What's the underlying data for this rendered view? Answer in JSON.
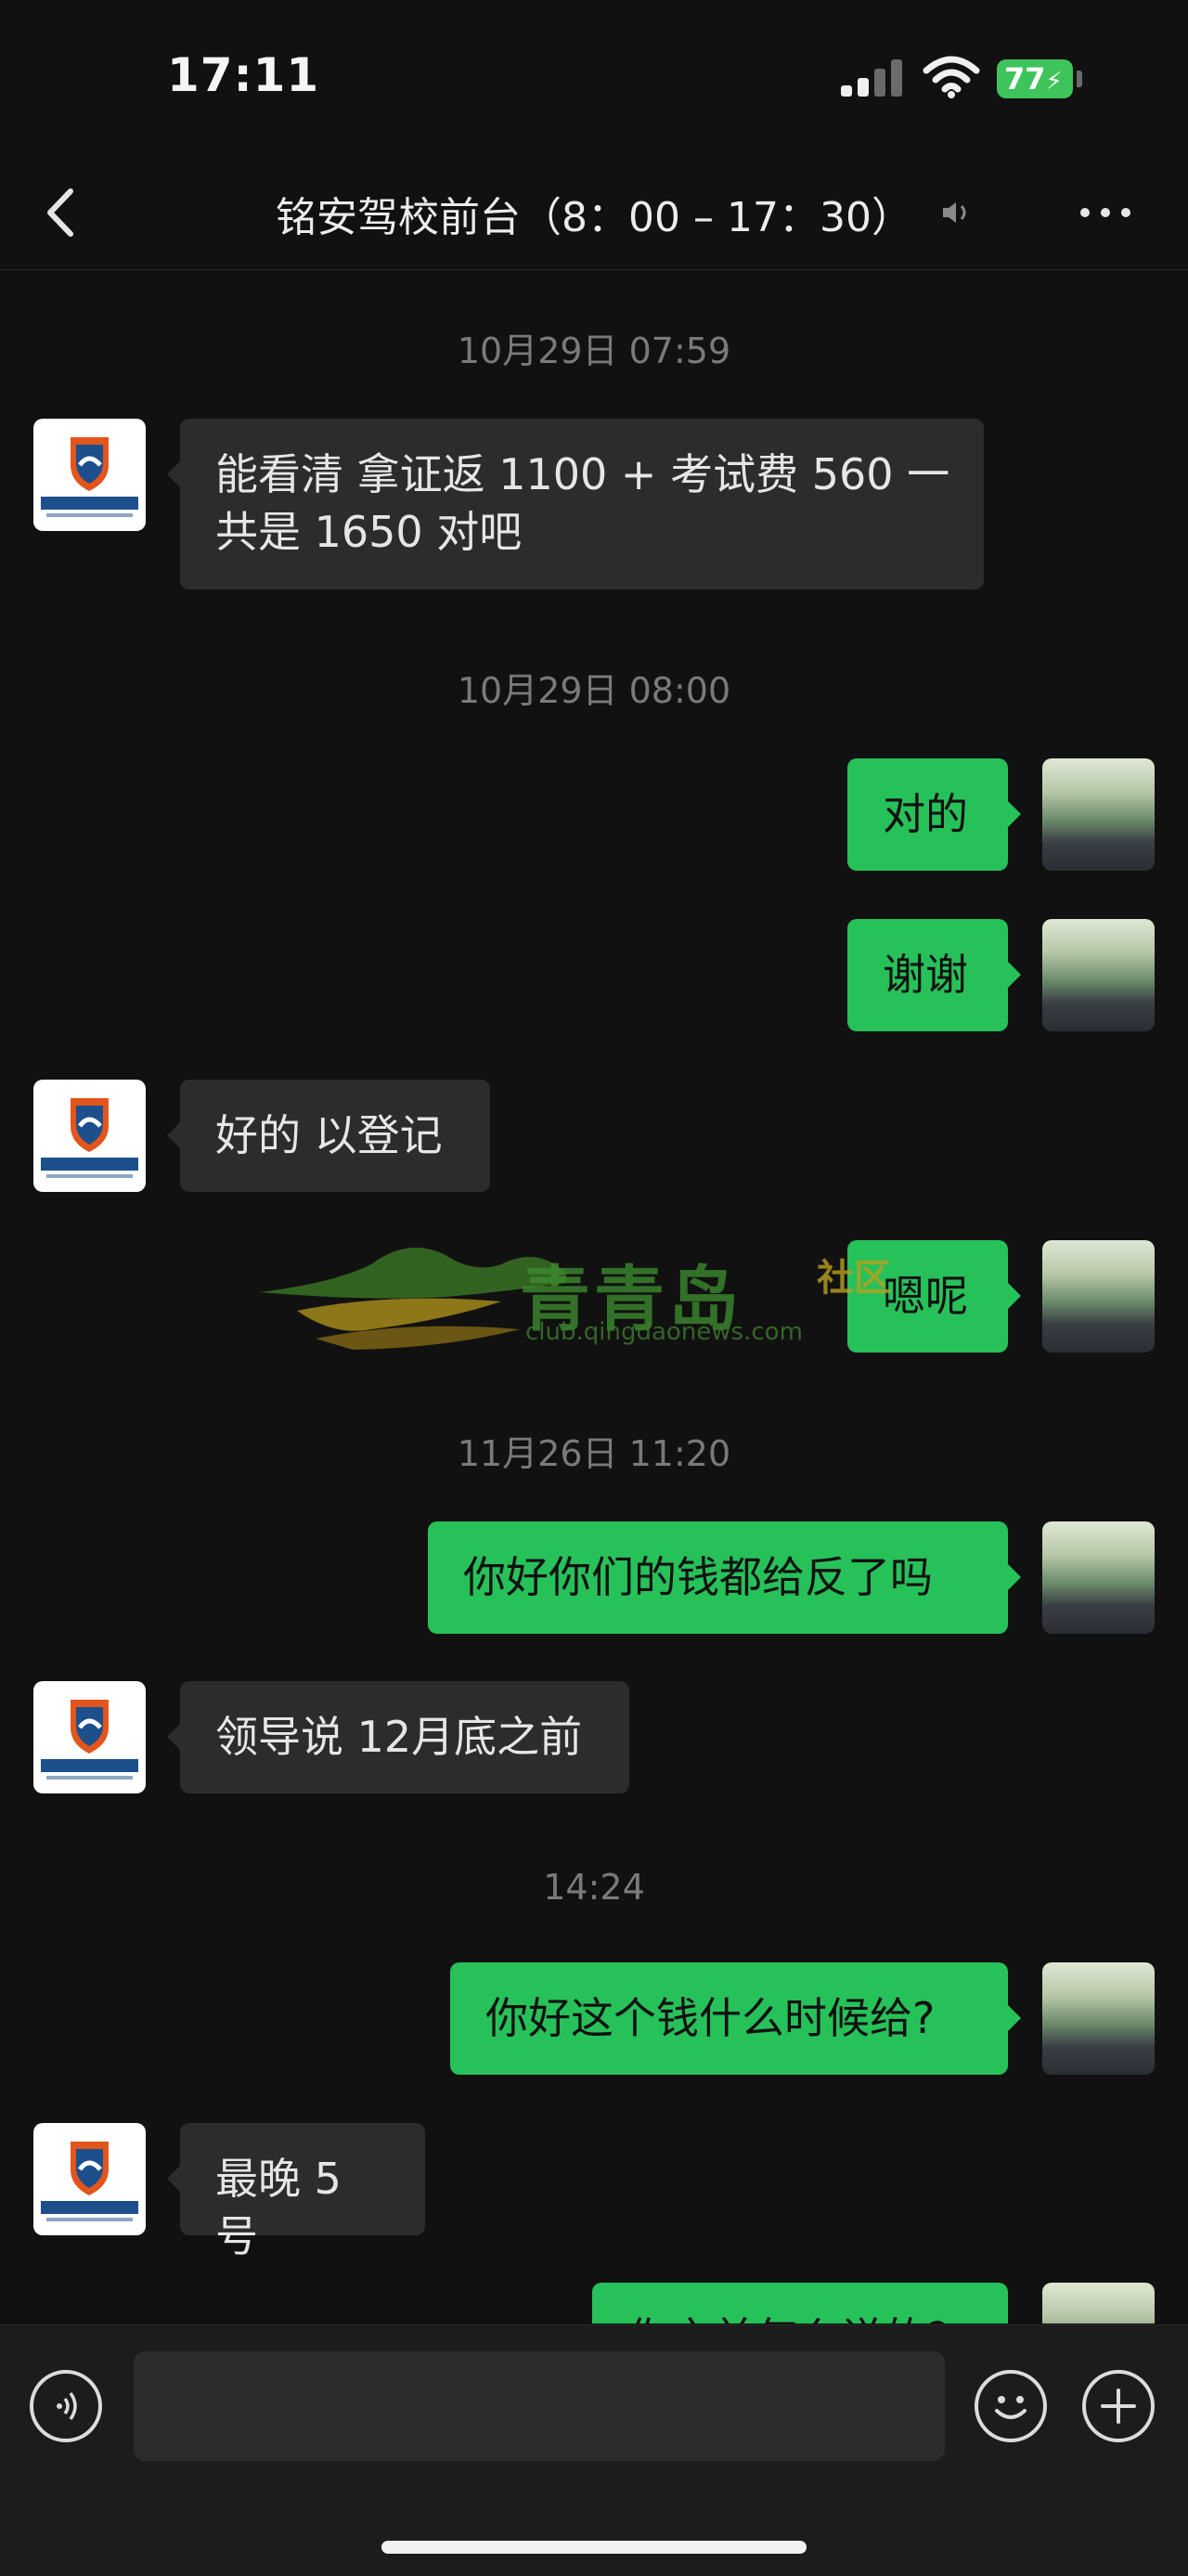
{
  "status_bar": {
    "time": "17:11",
    "battery": "77"
  },
  "header": {
    "title": "铭安驾校前台（8：00 – 17：30）"
  },
  "messages": [
    {
      "type": "timestamp",
      "text": "10月29日 07:59"
    },
    {
      "type": "incoming",
      "line1": "能看清  拿证返 1100 + 考试费 560 一",
      "line2": "共是 1650 对吧"
    },
    {
      "type": "timestamp",
      "text": "10月29日 08:00"
    },
    {
      "type": "outgoing",
      "text": "对的"
    },
    {
      "type": "outgoing",
      "text": "谢谢"
    },
    {
      "type": "incoming",
      "text": "好的 以登记"
    },
    {
      "type": "outgoing",
      "text": "嗯呢"
    },
    {
      "type": "timestamp",
      "text": "11月26日 11:20"
    },
    {
      "type": "outgoing",
      "text": "你好你们的钱都给反了吗"
    },
    {
      "type": "incoming",
      "text": "领导说 12月底之前"
    },
    {
      "type": "timestamp",
      "text": "14:24"
    },
    {
      "type": "outgoing",
      "text": "你好这个钱什么时候给?"
    },
    {
      "type": "incoming",
      "text": "最晚 5 号"
    },
    {
      "type": "outgoing",
      "text": "你之前怎么说的？"
    }
  ],
  "avatars": {
    "school_label": "青岛铭安驾校",
    "school_sub": "QINGDAO MINGAN DRIVING SCHOOL"
  },
  "watermark": {
    "title": "青青岛",
    "badge": "社区",
    "url": "club.qingdaonews.com"
  },
  "input_bar": {
    "placeholder": ""
  },
  "colors": {
    "background": "#111111",
    "incoming_bubble": "#2c2c2c",
    "outgoing_bubble": "#27c15a",
    "battery": "#3ec45a"
  }
}
